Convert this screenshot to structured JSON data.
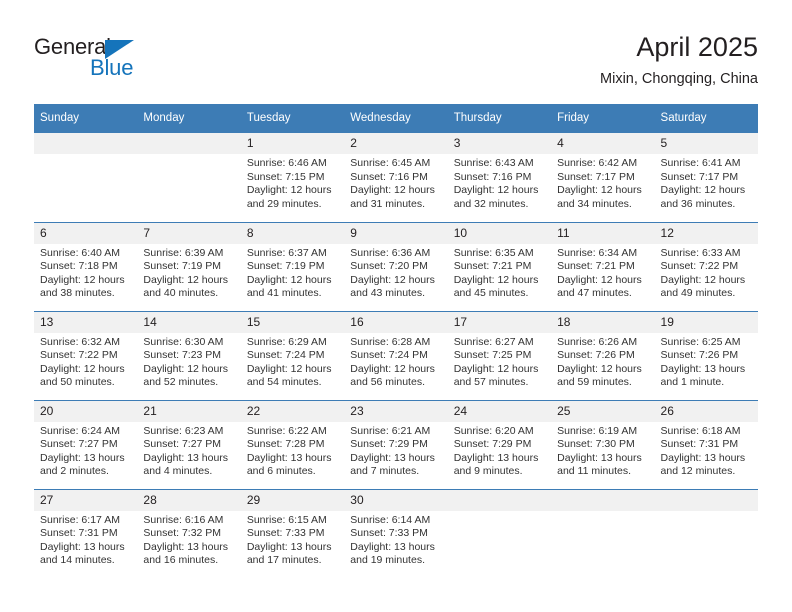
{
  "logo": {
    "word1": "General",
    "word2": "Blue",
    "triangle_color": "#1574bb"
  },
  "header": {
    "title": "April 2025",
    "subtitle": "Mixin, Chongqing, China"
  },
  "colors": {
    "header_blue": "#3d7cb5",
    "daynum_band": "#f1f1f1",
    "text": "#231f20"
  },
  "weekday_headers": [
    "Sunday",
    "Monday",
    "Tuesday",
    "Wednesday",
    "Thursday",
    "Friday",
    "Saturday"
  ],
  "weeks": [
    [
      {
        "day": "",
        "lines": []
      },
      {
        "day": "",
        "lines": []
      },
      {
        "day": "1",
        "lines": [
          "Sunrise: 6:46 AM",
          "Sunset: 7:15 PM",
          "Daylight: 12 hours and 29 minutes."
        ]
      },
      {
        "day": "2",
        "lines": [
          "Sunrise: 6:45 AM",
          "Sunset: 7:16 PM",
          "Daylight: 12 hours and 31 minutes."
        ]
      },
      {
        "day": "3",
        "lines": [
          "Sunrise: 6:43 AM",
          "Sunset: 7:16 PM",
          "Daylight: 12 hours and 32 minutes."
        ]
      },
      {
        "day": "4",
        "lines": [
          "Sunrise: 6:42 AM",
          "Sunset: 7:17 PM",
          "Daylight: 12 hours and 34 minutes."
        ]
      },
      {
        "day": "5",
        "lines": [
          "Sunrise: 6:41 AM",
          "Sunset: 7:17 PM",
          "Daylight: 12 hours and 36 minutes."
        ]
      }
    ],
    [
      {
        "day": "6",
        "lines": [
          "Sunrise: 6:40 AM",
          "Sunset: 7:18 PM",
          "Daylight: 12 hours and 38 minutes."
        ]
      },
      {
        "day": "7",
        "lines": [
          "Sunrise: 6:39 AM",
          "Sunset: 7:19 PM",
          "Daylight: 12 hours and 40 minutes."
        ]
      },
      {
        "day": "8",
        "lines": [
          "Sunrise: 6:37 AM",
          "Sunset: 7:19 PM",
          "Daylight: 12 hours and 41 minutes."
        ]
      },
      {
        "day": "9",
        "lines": [
          "Sunrise: 6:36 AM",
          "Sunset: 7:20 PM",
          "Daylight: 12 hours and 43 minutes."
        ]
      },
      {
        "day": "10",
        "lines": [
          "Sunrise: 6:35 AM",
          "Sunset: 7:21 PM",
          "Daylight: 12 hours and 45 minutes."
        ]
      },
      {
        "day": "11",
        "lines": [
          "Sunrise: 6:34 AM",
          "Sunset: 7:21 PM",
          "Daylight: 12 hours and 47 minutes."
        ]
      },
      {
        "day": "12",
        "lines": [
          "Sunrise: 6:33 AM",
          "Sunset: 7:22 PM",
          "Daylight: 12 hours and 49 minutes."
        ]
      }
    ],
    [
      {
        "day": "13",
        "lines": [
          "Sunrise: 6:32 AM",
          "Sunset: 7:22 PM",
          "Daylight: 12 hours and 50 minutes."
        ]
      },
      {
        "day": "14",
        "lines": [
          "Sunrise: 6:30 AM",
          "Sunset: 7:23 PM",
          "Daylight: 12 hours and 52 minutes."
        ]
      },
      {
        "day": "15",
        "lines": [
          "Sunrise: 6:29 AM",
          "Sunset: 7:24 PM",
          "Daylight: 12 hours and 54 minutes."
        ]
      },
      {
        "day": "16",
        "lines": [
          "Sunrise: 6:28 AM",
          "Sunset: 7:24 PM",
          "Daylight: 12 hours and 56 minutes."
        ]
      },
      {
        "day": "17",
        "lines": [
          "Sunrise: 6:27 AM",
          "Sunset: 7:25 PM",
          "Daylight: 12 hours and 57 minutes."
        ]
      },
      {
        "day": "18",
        "lines": [
          "Sunrise: 6:26 AM",
          "Sunset: 7:26 PM",
          "Daylight: 12 hours and 59 minutes."
        ]
      },
      {
        "day": "19",
        "lines": [
          "Sunrise: 6:25 AM",
          "Sunset: 7:26 PM",
          "Daylight: 13 hours and 1 minute."
        ]
      }
    ],
    [
      {
        "day": "20",
        "lines": [
          "Sunrise: 6:24 AM",
          "Sunset: 7:27 PM",
          "Daylight: 13 hours and 2 minutes."
        ]
      },
      {
        "day": "21",
        "lines": [
          "Sunrise: 6:23 AM",
          "Sunset: 7:27 PM",
          "Daylight: 13 hours and 4 minutes."
        ]
      },
      {
        "day": "22",
        "lines": [
          "Sunrise: 6:22 AM",
          "Sunset: 7:28 PM",
          "Daylight: 13 hours and 6 minutes."
        ]
      },
      {
        "day": "23",
        "lines": [
          "Sunrise: 6:21 AM",
          "Sunset: 7:29 PM",
          "Daylight: 13 hours and 7 minutes."
        ]
      },
      {
        "day": "24",
        "lines": [
          "Sunrise: 6:20 AM",
          "Sunset: 7:29 PM",
          "Daylight: 13 hours and 9 minutes."
        ]
      },
      {
        "day": "25",
        "lines": [
          "Sunrise: 6:19 AM",
          "Sunset: 7:30 PM",
          "Daylight: 13 hours and 11 minutes."
        ]
      },
      {
        "day": "26",
        "lines": [
          "Sunrise: 6:18 AM",
          "Sunset: 7:31 PM",
          "Daylight: 13 hours and 12 minutes."
        ]
      }
    ],
    [
      {
        "day": "27",
        "lines": [
          "Sunrise: 6:17 AM",
          "Sunset: 7:31 PM",
          "Daylight: 13 hours and 14 minutes."
        ]
      },
      {
        "day": "28",
        "lines": [
          "Sunrise: 6:16 AM",
          "Sunset: 7:32 PM",
          "Daylight: 13 hours and 16 minutes."
        ]
      },
      {
        "day": "29",
        "lines": [
          "Sunrise: 6:15 AM",
          "Sunset: 7:33 PM",
          "Daylight: 13 hours and 17 minutes."
        ]
      },
      {
        "day": "30",
        "lines": [
          "Sunrise: 6:14 AM",
          "Sunset: 7:33 PM",
          "Daylight: 13 hours and 19 minutes."
        ]
      },
      {
        "day": "",
        "lines": []
      },
      {
        "day": "",
        "lines": []
      },
      {
        "day": "",
        "lines": []
      }
    ]
  ]
}
